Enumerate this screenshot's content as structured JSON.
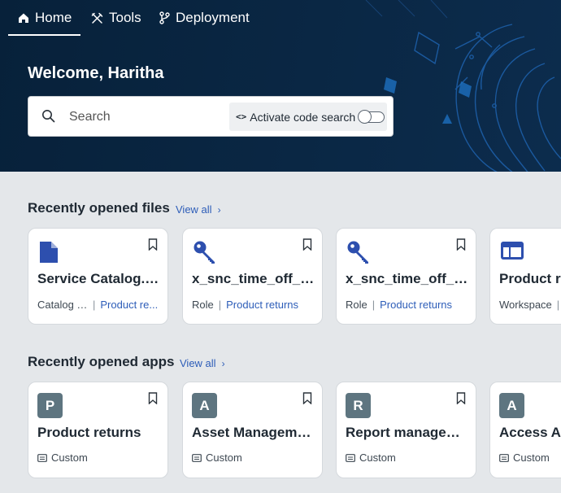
{
  "nav": {
    "items": [
      {
        "label": "Home",
        "icon": "home-icon"
      },
      {
        "label": "Tools",
        "icon": "tools-icon"
      },
      {
        "label": "Deployment",
        "icon": "branch-icon"
      }
    ],
    "active": "Home"
  },
  "hero": {
    "welcome": "Welcome, Haritha",
    "search_placeholder": "Search",
    "code_search_label": "Activate code search",
    "code_search_enabled": false
  },
  "files": {
    "title": "Recently opened files",
    "view_all": "View all",
    "cards": [
      {
        "icon": "document-icon",
        "title": "Service Catalog.T...",
        "type": "Catalog It...",
        "link": "Product re..."
      },
      {
        "icon": "key-icon",
        "title": "x_snc_time_off_r_...",
        "type": "Role",
        "link": "Product returns"
      },
      {
        "icon": "key-icon",
        "title": "x_snc_time_off_r_...",
        "type": "Role",
        "link": "Product returns"
      },
      {
        "icon": "workspace-icon",
        "title": "Product re",
        "type": "Workspace",
        "link": ""
      }
    ]
  },
  "apps": {
    "title": "Recently opened apps",
    "view_all": "View all",
    "cards": [
      {
        "letter": "P",
        "title": "Product returns",
        "scope": "Custom"
      },
      {
        "letter": "A",
        "title": "Asset Manageme...",
        "scope": "Custom"
      },
      {
        "letter": "R",
        "title": "Report managem...",
        "scope": "Custom"
      },
      {
        "letter": "A",
        "title": "Access An",
        "scope": "Custom"
      }
    ]
  },
  "colors": {
    "hero_bg": "#07213a",
    "accent_blue": "#2d4fae",
    "link": "#2d5db8",
    "badge": "#5e7580",
    "page_bg": "#e4e7ea"
  }
}
